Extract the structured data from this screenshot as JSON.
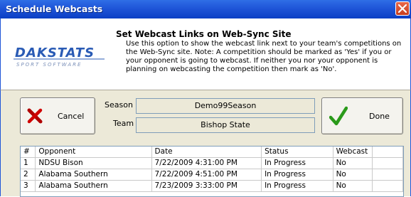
{
  "window": {
    "title": "Schedule Webcasts"
  },
  "header": {
    "title": "Set Webcast Links on Web-Sync Site",
    "description": "Use this option to show the webcast link next to your team's competitions on the Web-Sync site.  Note: A competition should be marked as 'Yes' if you or your opponent is going to webcast.  If neither you nor your opponent is planning on webcasting the competition then mark as 'No'.",
    "logo_text": "DAKSTATS",
    "logo_subtext": "SPORT SOFTWARE"
  },
  "buttons": {
    "cancel_label": "Cancel",
    "done_label": "Done"
  },
  "fields": {
    "season_label": "Season",
    "season_value": "Demo99Season",
    "team_label": "Team",
    "team_value": "Bishop State"
  },
  "table": {
    "columns": [
      "#",
      "Opponent",
      "Date",
      "Status",
      "Webcast"
    ],
    "rows": [
      [
        "1",
        "NDSU Bison",
        "7/22/2009 4:31:00 PM",
        "In Progress",
        "No"
      ],
      [
        "2",
        "Alabama Southern",
        "7/22/2009 4:51:00 PM",
        "In Progress",
        "No"
      ],
      [
        "3",
        "Alabama Southern",
        "7/23/2009 3:33:00 PM",
        "In Progress",
        "No"
      ]
    ]
  },
  "colors": {
    "titlebar": "#1f55d8",
    "dialog_bg": "#ece9d8",
    "logo_blue": "#2a5bb5"
  },
  "icons": {
    "close": "close-icon",
    "cancel": "red-x-icon",
    "done": "green-check-icon"
  }
}
